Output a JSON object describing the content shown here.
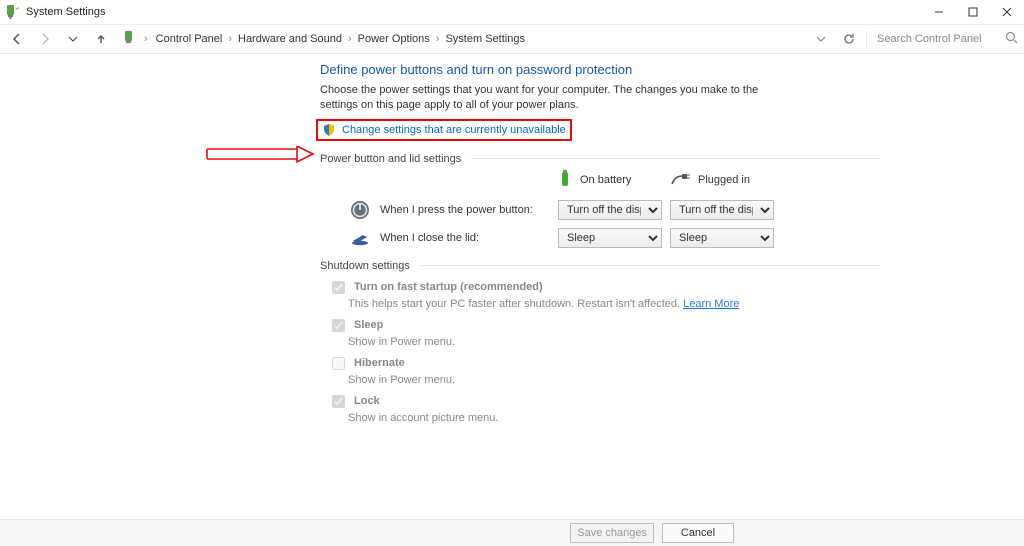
{
  "window": {
    "title": "System Settings"
  },
  "breadcrumbs": {
    "c0": "Control Panel",
    "c1": "Hardware and Sound",
    "c2": "Power Options",
    "c3": "System Settings"
  },
  "search": {
    "placeholder": "Search Control Panel"
  },
  "page": {
    "heading": "Define power buttons and turn on password protection",
    "desc": "Choose the power settings that you want for your computer. The changes you make to the settings on this page apply to all of your power plans.",
    "change_link": "Change settings that are currently unavailable",
    "section_power": "Power button and lid settings",
    "col_battery": "On battery",
    "col_plugged": "Plugged in",
    "row_power_button": "When I press the power button:",
    "row_lid": "When I close the lid:",
    "power_battery": "Turn off the display",
    "power_plugged": "Turn off the display",
    "lid_battery": "Sleep",
    "lid_plugged": "Sleep",
    "section_shutdown": "Shutdown settings",
    "opts": {
      "fast": {
        "label": "Turn on fast startup (recommended)",
        "sub_a": "This helps start your PC faster after shutdown. Restart isn't affected. ",
        "learn": "Learn More"
      },
      "sleep": {
        "label": "Sleep",
        "sub": "Show in Power menu."
      },
      "hibernate": {
        "label": "Hibernate",
        "sub": "Show in Power menu."
      },
      "lock": {
        "label": "Lock",
        "sub": "Show in account picture menu."
      }
    }
  },
  "footer": {
    "save": "Save changes",
    "cancel": "Cancel"
  }
}
